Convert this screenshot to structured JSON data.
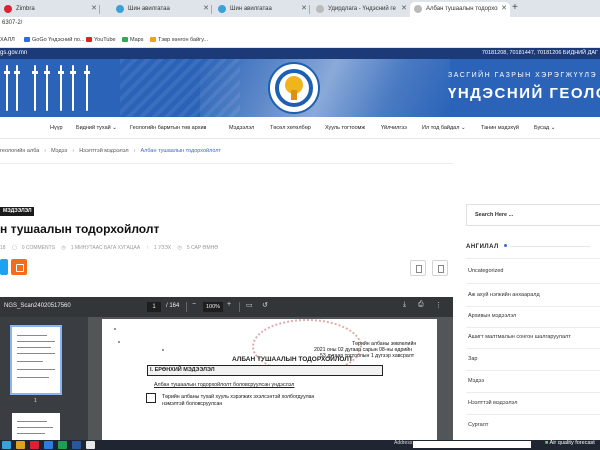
{
  "browser": {
    "tabs": [
      {
        "label": "Zimbra",
        "active": false
      },
      {
        "label": "Шин авилгатаа",
        "active": false
      },
      {
        "label": "Шин авилгатаа",
        "active": false
      },
      {
        "label": "Удирдлага - Үндэсний геолог...",
        "active": false
      },
      {
        "label": "Албан тушаалын тодорхойлолт",
        "active": true
      }
    ],
    "new_tab": "+",
    "url": "6307-2/",
    "bookmarks": [
      "ХАЛЛ",
      "GoGo Үндэсний по...",
      "YouTube",
      "Maps",
      "Тэвр хөнгон байгу..."
    ]
  },
  "site": {
    "domain": "gs.gov.mn",
    "phone": "70181208, 70181447, 70181206  БИДНИЙ ДАГ",
    "tagline_top": "ЗАСГИЙН ГАЗРЫН ХЭРЭГЖҮҮЛЭ",
    "tagline_main": "ҮНДЭСНИЙ ГЕОЛОГИ",
    "emblem_year": "1939"
  },
  "nav": [
    "Нүүр",
    "Бидний тухай ⌄",
    "Геологийн бармтын төв архив",
    "Мэдээлэл",
    "Төсөл хөтөлбөр",
    "Хууль тогтоомж",
    "Үйлчилгээ",
    "Ил тод байдал ⌄",
    "Танин мэдэхүй",
    "Бусад ⌄"
  ],
  "breadcrumb": {
    "items": [
      "геологийн алба",
      "Мэдээ",
      "Нээлттэй мэдээлэл"
    ],
    "current": "Албан тушаалын тодорхойлолт"
  },
  "article": {
    "category": "МЭДЭЭЛЭЛ",
    "title": "н тушаалын тодорхойлолт",
    "meta": [
      "18",
      "0 COMMENTS",
      "1 МИНУТААС БАГА ХУГАЦАА",
      "1 УЗЭХ",
      "5 САР ӨМНӨ"
    ]
  },
  "pdf": {
    "filename": "NGS_Scan24020517560",
    "page": "1",
    "total": "/ 164",
    "zoom": "100%",
    "thumb_page": "1",
    "doc": {
      "approval": [
        "Төрийн албаны зөвлөлийн",
        "2021 оны 02 дугаар сарын 08-ны өдрийн",
        "53  дугаар тогтоолын 1 дүгээр хавсралт"
      ],
      "heading": "АЛБАН ТУШААЛЫН ТОДОРХОЙЛОЛТ",
      "section": "I. ЕРӨНХИЙ МЭДЭЭЛЭЛ",
      "subheading": "Албан тушаалын тодорхойлолт боловсруулсан үндэслэл",
      "line1": "Төрийн албаны тухай хууль хэрэгжих эхэлсэнтэй холбогдуулан",
      "line2": "нэмэлтэй боловсруулсан"
    }
  },
  "sidebar": {
    "search_placeholder": "Search Here ...",
    "categories_title": "АНГИЛАЛ",
    "categories": [
      "Uncategorized",
      "Аж ахуй нэгжийн анхааралд",
      "Архивын мэдээлэл",
      "Ашигт малтмалын сонгон шалгаруулалт",
      "Зар",
      "Мэдээ",
      "Нээлттэй мэдээлэл",
      "Сургалт"
    ]
  },
  "taskbar": {
    "address_label": "Address",
    "weather": "Air quality forecast"
  }
}
